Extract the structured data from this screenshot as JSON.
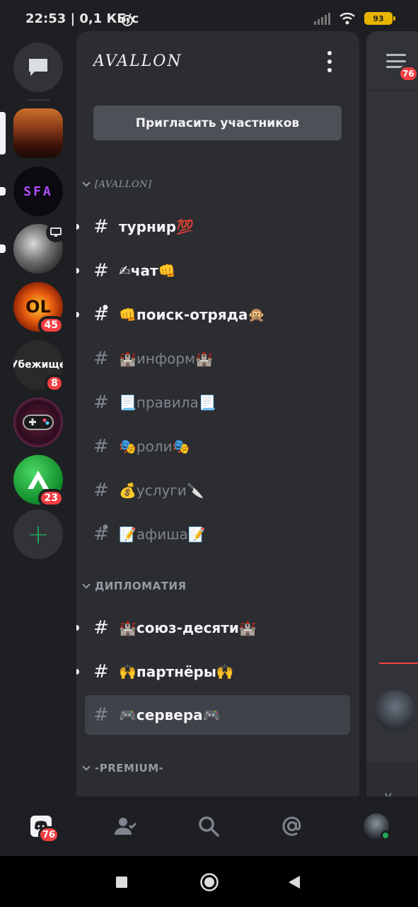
{
  "status_bar": {
    "time": "22:53 | 0,1 КБ/с",
    "battery": "93"
  },
  "rail": {
    "servers": [
      {
        "name": "server-1",
        "mention": null
      },
      {
        "name": "server-2",
        "mention": null
      },
      {
        "name": "server-3",
        "mention": null
      },
      {
        "name": "server-4",
        "mention": "45"
      },
      {
        "name": "server-5",
        "mention": "8",
        "label": "Убежище"
      },
      {
        "name": "server-6",
        "mention": null
      },
      {
        "name": "server-7",
        "mention": "23"
      }
    ],
    "add_label": "+"
  },
  "panel": {
    "server_name": "AVALLON",
    "invite_label": "Пригласить участников",
    "categories": [
      {
        "label": "[AVALLON]"
      },
      {
        "label": "ДИПЛОМАТИЯ"
      },
      {
        "label": "-PREMIUM-"
      }
    ],
    "channels": [
      {
        "name": "турнир💯",
        "state": "unread",
        "locked": false
      },
      {
        "name": "✍чат👊",
        "state": "unread",
        "locked": false
      },
      {
        "name": "👊поиск-отряда🙊",
        "state": "unread",
        "locked": true
      },
      {
        "name": "🏰информ🏰",
        "state": "read",
        "locked": false
      },
      {
        "name": "📃правила📃",
        "state": "read",
        "locked": false
      },
      {
        "name": "🎭роли🎭",
        "state": "read",
        "locked": false
      },
      {
        "name": "💰услуги🔪",
        "state": "read",
        "locked": false
      },
      {
        "name": "📝афиша📝",
        "state": "read",
        "locked": true
      },
      {
        "name": "🏰союз-десяти🏰",
        "state": "unread",
        "locked": false
      },
      {
        "name": "🙌партнёры🙌",
        "state": "unread",
        "locked": false
      },
      {
        "name": "🎮сервера🎮",
        "state": "selected",
        "locked": false
      }
    ]
  },
  "peek": {
    "badge": "76",
    "footer_text": "У"
  },
  "tabbar": {
    "home_badge": "76"
  },
  "colors": {
    "background": "#1e1f22",
    "panel": "#2b2d31",
    "accent_red": "#f23f43",
    "online_green": "#23a55a"
  }
}
